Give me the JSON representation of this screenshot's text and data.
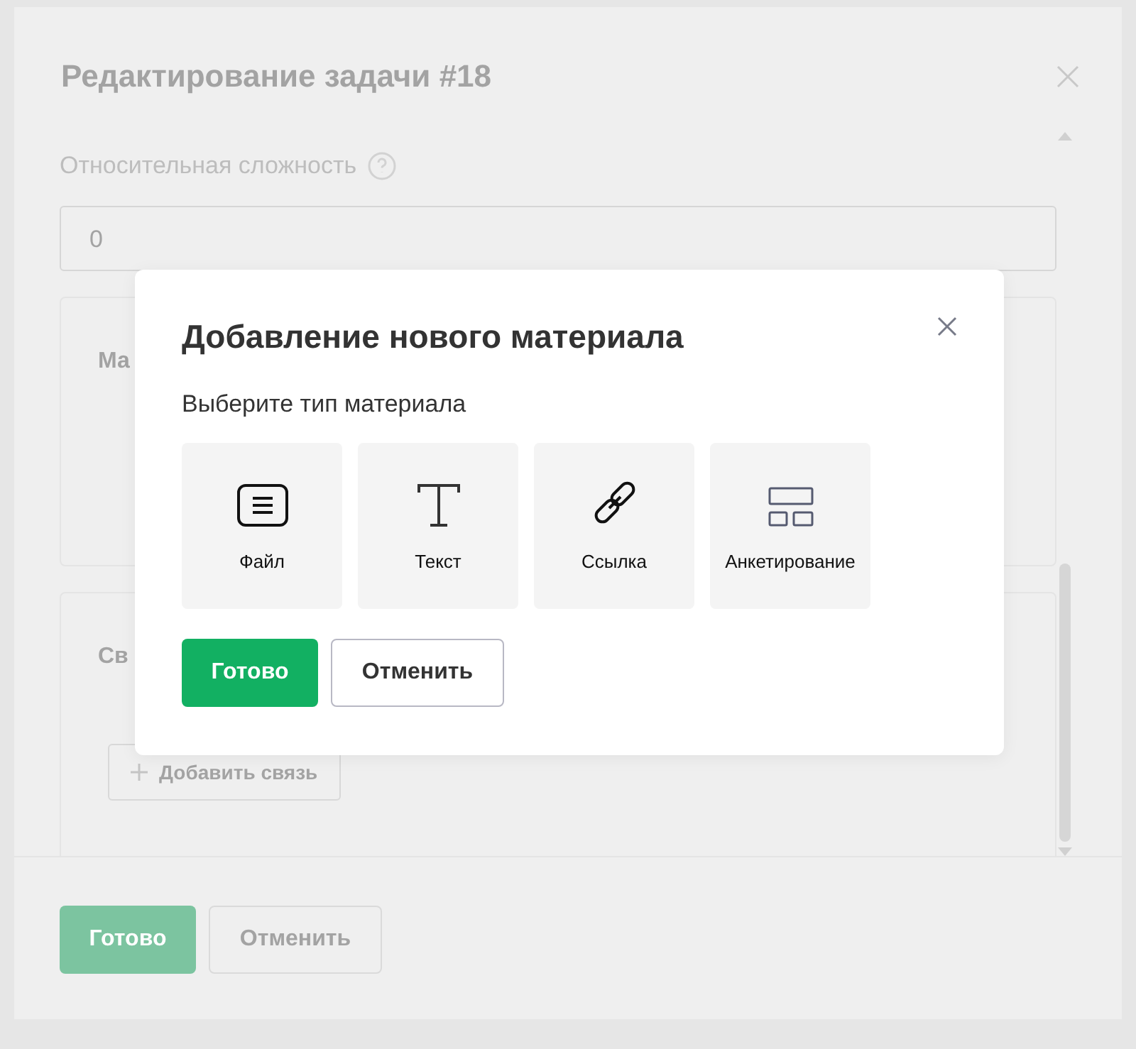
{
  "background_dialog": {
    "title": "Редактирование задачи #18",
    "field": {
      "label": "Относительная сложность",
      "value": "0"
    },
    "sections": [
      {
        "heading": "Ма"
      },
      {
        "heading": "Св",
        "button": "Добавить связь"
      }
    ],
    "buttons": [
      {
        "label": "Готово",
        "kind": "primary",
        "disabled": true
      },
      {
        "label": "Отменить",
        "kind": "secondary",
        "disabled": true
      }
    ]
  },
  "modal": {
    "title": "Добавление нового материала",
    "subtitle": "Выберите тип материала",
    "types": [
      {
        "label": "Файл",
        "kind": "file"
      },
      {
        "label": "Текст",
        "kind": "text"
      },
      {
        "label": "Ссылка",
        "kind": "link"
      },
      {
        "label": "Анкетирование",
        "kind": "survey"
      }
    ],
    "buttons": [
      {
        "label": "Готово",
        "kind": "primary",
        "disabled": false
      },
      {
        "label": "Отменить",
        "kind": "secondary",
        "disabled": false
      }
    ]
  }
}
